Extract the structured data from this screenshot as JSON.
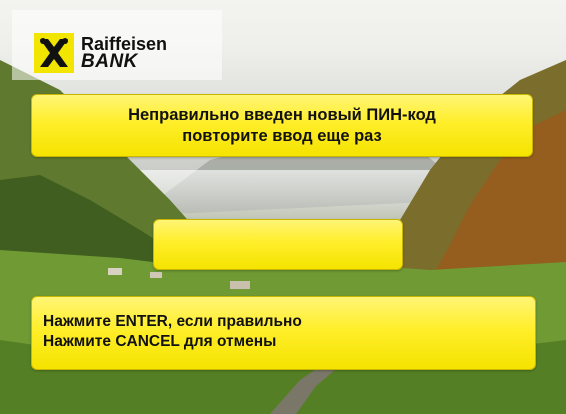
{
  "logo": {
    "icon": "raiffeisen-crossed-horse-heads-icon",
    "line1": "Raiffeisen",
    "line2": "BANK"
  },
  "message": {
    "line1": "Неправильно введен новый ПИН-код",
    "line2": "повторите ввод еще раз"
  },
  "pin_field": {
    "value": ""
  },
  "instructions": {
    "line1": "Нажмите ENTER, если правильно",
    "line2": "Нажмите CANCEL для отмены"
  },
  "colors": {
    "panel_yellow": "#ffee2a",
    "brand_yellow": "#f2e600",
    "text": "#111111"
  }
}
